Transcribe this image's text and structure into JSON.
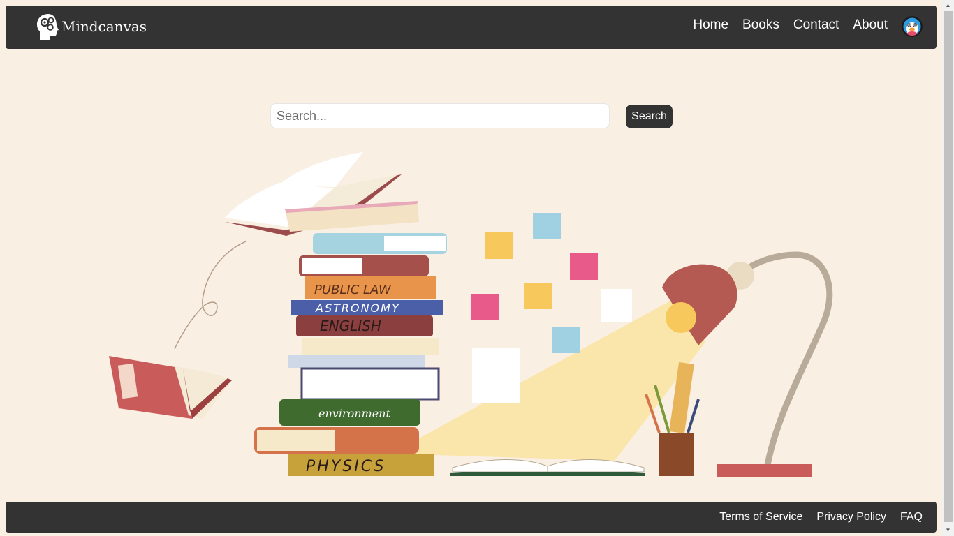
{
  "brand": {
    "name": "Mindcanvas"
  },
  "nav": {
    "links": [
      "Home",
      "Books",
      "Contact",
      "About"
    ]
  },
  "search": {
    "placeholder": "Search...",
    "button_label": "Search"
  },
  "hero": {
    "book_titles": [
      "PUBLIC LAW",
      "ASTRONOMY",
      "ENGLISH",
      "environment",
      "PHYSICS"
    ]
  },
  "footer": {
    "links": [
      "Terms of Service",
      "Privacy Policy",
      "FAQ"
    ]
  },
  "colors": {
    "background": "#faefe3",
    "bar": "#333333",
    "button": "#333333"
  },
  "icons": {
    "logo": "head-with-gears-icon",
    "avatar": "penguin-avatar-icon"
  }
}
